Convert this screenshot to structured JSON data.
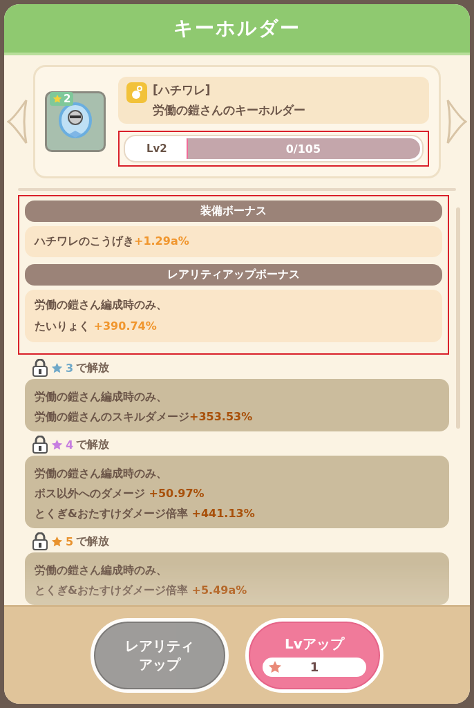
{
  "window": {
    "title": "キーホルダー"
  },
  "item": {
    "rarity": "2",
    "category": "[ハチワレ]",
    "name": "労働の鎧さんのキーホルダー",
    "level_label": "Lv2",
    "level": 0,
    "progress": "0/105"
  },
  "sections": [
    {
      "title": "装備ボーナス",
      "lines": [
        {
          "text": "ハチワレのこうげき",
          "value": "+1.29a%"
        }
      ]
    },
    {
      "title": "レアリティアップボーナス",
      "lines": [
        {
          "text": "労働の鎧さん編成時のみ、"
        },
        {
          "text": "たいりょく ",
          "value": "+390.74%"
        }
      ]
    }
  ],
  "locked_bonuses": [
    {
      "locked": true,
      "star": "3",
      "color": "#6fa8c8",
      "unlock": "で解放",
      "lines": [
        {
          "text": "労働の鎧さん編成時のみ、"
        },
        {
          "text": "労働の鎧さんのスキルダメージ",
          "value": "+353.53%"
        }
      ]
    },
    {
      "locked": true,
      "star": "4",
      "color": "#c77ee0",
      "unlock": "で解放",
      "lines": [
        {
          "text": "労働の鎧さん編成時のみ、"
        },
        {
          "text": "ボス以外へのダメージ ",
          "value": "+50.97%"
        },
        {
          "text": "とくぎ&おたすけダメージ倍率 ",
          "value": "+441.13%"
        }
      ]
    },
    {
      "locked": true,
      "star": "5",
      "color": "#e8922e",
      "unlock": "で解放",
      "lines": [
        {
          "text": "労働の鎧さん編成時のみ、"
        },
        {
          "text": "とくぎ&おたすけダメージ倍率 ",
          "value": "+5.49a%"
        }
      ]
    }
  ],
  "buttons": [
    {
      "kind": "rarity",
      "label": "レアリティアップ",
      "disabled": true
    },
    {
      "kind": "levelup",
      "label": "Lvアップ",
      "cost": "1",
      "disabled": false
    }
  ]
}
